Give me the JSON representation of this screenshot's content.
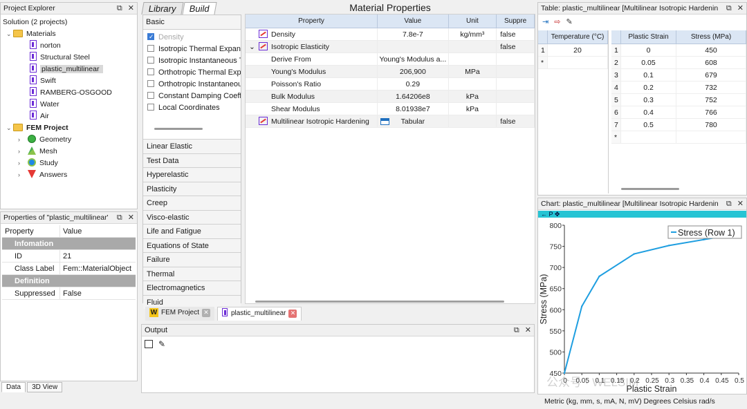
{
  "project_explorer": {
    "title": "Project Explorer",
    "items": [
      {
        "label": "Solution (2 projects)",
        "level": 0,
        "type": "solution"
      },
      {
        "label": "Materials",
        "level": 1,
        "type": "folder",
        "expanded": true
      },
      {
        "label": "norton",
        "level": 2,
        "type": "material"
      },
      {
        "label": "Structural Steel",
        "level": 2,
        "type": "material"
      },
      {
        "label": "plastic_multilinear",
        "level": 2,
        "type": "material",
        "selected": true
      },
      {
        "label": "Swift",
        "level": 2,
        "type": "material"
      },
      {
        "label": "RAMBERG-OSGOOD",
        "level": 2,
        "type": "material"
      },
      {
        "label": "Water",
        "level": 2,
        "type": "material"
      },
      {
        "label": "Air",
        "level": 2,
        "type": "material"
      },
      {
        "label": "FEM Project",
        "level": 1,
        "type": "folder",
        "expanded": true,
        "bold": true
      },
      {
        "label": "Geometry",
        "level": 2,
        "type": "geometry"
      },
      {
        "label": "Mesh",
        "level": 2,
        "type": "mesh"
      },
      {
        "label": "Study",
        "level": 2,
        "type": "study"
      },
      {
        "label": "Answers",
        "level": 2,
        "type": "answers"
      }
    ]
  },
  "properties_panel": {
    "title": "Properties of \"plastic_multilinear\"",
    "col_property": "Property",
    "col_value": "Value",
    "group1": "Infomation",
    "rows1": [
      {
        "name": "ID",
        "value": "21"
      },
      {
        "name": "Class Label",
        "value": "Fem::MaterialObject"
      }
    ],
    "group2": "Definition",
    "rows2": [
      {
        "name": "Suppressed",
        "value": "False"
      }
    ],
    "tabs": [
      "Data",
      "3D View"
    ]
  },
  "library": {
    "tabs": [
      "Library",
      "Build"
    ],
    "active_tab": "Build",
    "basic_header": "Basic",
    "basic_items": [
      {
        "label": "Density",
        "checked": true,
        "disabled": true
      },
      {
        "label": "Isotropic Thermal Expans",
        "checked": false
      },
      {
        "label": "Isotropic Instantaneous T",
        "checked": false
      },
      {
        "label": "Orthotropic Thermal Exp",
        "checked": false
      },
      {
        "label": "Orthotropic Instantaneou",
        "checked": false
      },
      {
        "label": "Constant Damping Coeff",
        "checked": false
      },
      {
        "label": "Local Coordinates",
        "checked": false
      }
    ],
    "categories": [
      "Linear Elastic",
      "Test Data",
      "Hyperelastic",
      "Plasticity",
      "Creep",
      "Visco-elastic",
      "Life and Fatigue",
      "Equations of State",
      "Failure",
      "Thermal",
      "Electromagnetics",
      "Fluid"
    ]
  },
  "material_properties": {
    "title": "Material Properties",
    "columns": [
      "Property",
      "Value",
      "Unit",
      "Suppre"
    ],
    "rows": [
      {
        "property": "Density",
        "value": "7.8e-7",
        "unit": "kg/mm³",
        "suppressed": "false",
        "indent": 0,
        "icon": true
      },
      {
        "property": "Isotropic Elasticity",
        "value": "",
        "unit": "",
        "suppressed": "false",
        "indent": 0,
        "icon": true,
        "expander": "⌄"
      },
      {
        "property": "Derive From",
        "value": "Young's Modulus a...",
        "unit": "",
        "suppressed": "",
        "indent": 1
      },
      {
        "property": "Young's Modulus",
        "value": "206,900",
        "unit": "MPa",
        "suppressed": "",
        "indent": 1
      },
      {
        "property": "Poisson's Ratio",
        "value": "0.29",
        "unit": "",
        "suppressed": "",
        "indent": 1
      },
      {
        "property": "Bulk Modulus",
        "value": "1.64206e8",
        "unit": "kPa",
        "suppressed": "",
        "indent": 1
      },
      {
        "property": "Shear Modulus",
        "value": "8.01938e7",
        "unit": "kPa",
        "suppressed": "",
        "indent": 1
      },
      {
        "property": "Multilinear Isotropic Hardening",
        "value": "Tabular",
        "unit": "",
        "suppressed": "false",
        "indent": 0,
        "icon": true,
        "table_icon": true
      }
    ]
  },
  "doc_tabs": [
    {
      "label": "FEM Project",
      "icon": "W",
      "close_color": "#b0b0b0"
    },
    {
      "label": "plastic_multilinear",
      "icon": "material",
      "close_color": "#e57373"
    }
  ],
  "output": {
    "title": "Output"
  },
  "table_panel": {
    "title": "Table: plastic_multilinear [Multilinear Isotropic Hardening]",
    "temp_header": "Temperature (°C)",
    "temp_rows": [
      {
        "n": "1",
        "value": "20"
      },
      {
        "n": "*",
        "value": ""
      }
    ],
    "col_strain": "Plastic Strain",
    "col_stress": "Stress (MPa)",
    "rows": [
      {
        "n": "1",
        "strain": "0",
        "stress": "450"
      },
      {
        "n": "2",
        "strain": "0.05",
        "stress": "608"
      },
      {
        "n": "3",
        "strain": "0.1",
        "stress": "679"
      },
      {
        "n": "4",
        "strain": "0.2",
        "stress": "732"
      },
      {
        "n": "5",
        "strain": "0.3",
        "stress": "752"
      },
      {
        "n": "6",
        "strain": "0.4",
        "stress": "766"
      },
      {
        "n": "7",
        "strain": "0.5",
        "stress": "780"
      },
      {
        "n": "*",
        "strain": "",
        "stress": ""
      }
    ]
  },
  "chart_panel": {
    "title": "Chart: plastic_multilinear [Multilinear Isotropic Hardening]",
    "toolbar": "← P ✥"
  },
  "chart_data": {
    "type": "line",
    "title": "",
    "xlabel": "Plastic Strain",
    "ylabel": "Stress (MPa)",
    "xlim": [
      0,
      0.5
    ],
    "ylim": [
      450,
      800
    ],
    "xticks": [
      "0",
      "0.05",
      "0.1",
      "0.15",
      "0.2",
      "0.25",
      "0.3",
      "0.35",
      "0.4",
      "0.45",
      "0.5"
    ],
    "yticks": [
      "450",
      "500",
      "550",
      "600",
      "650",
      "700",
      "750",
      "800"
    ],
    "series": [
      {
        "name": "Stress (Row 1)",
        "color": "#1e9ee0",
        "x": [
          0,
          0.05,
          0.1,
          0.2,
          0.3,
          0.4,
          0.5
        ],
        "y": [
          450,
          608,
          679,
          732,
          752,
          766,
          780
        ]
      }
    ],
    "legend": "top-right",
    "grid": false
  },
  "status_bar": {
    "units": "Metric (kg, mm, s, mA, N, mV)  Degrees  Celsius  rad/s"
  },
  "watermark": "公众号 · WELSIM"
}
